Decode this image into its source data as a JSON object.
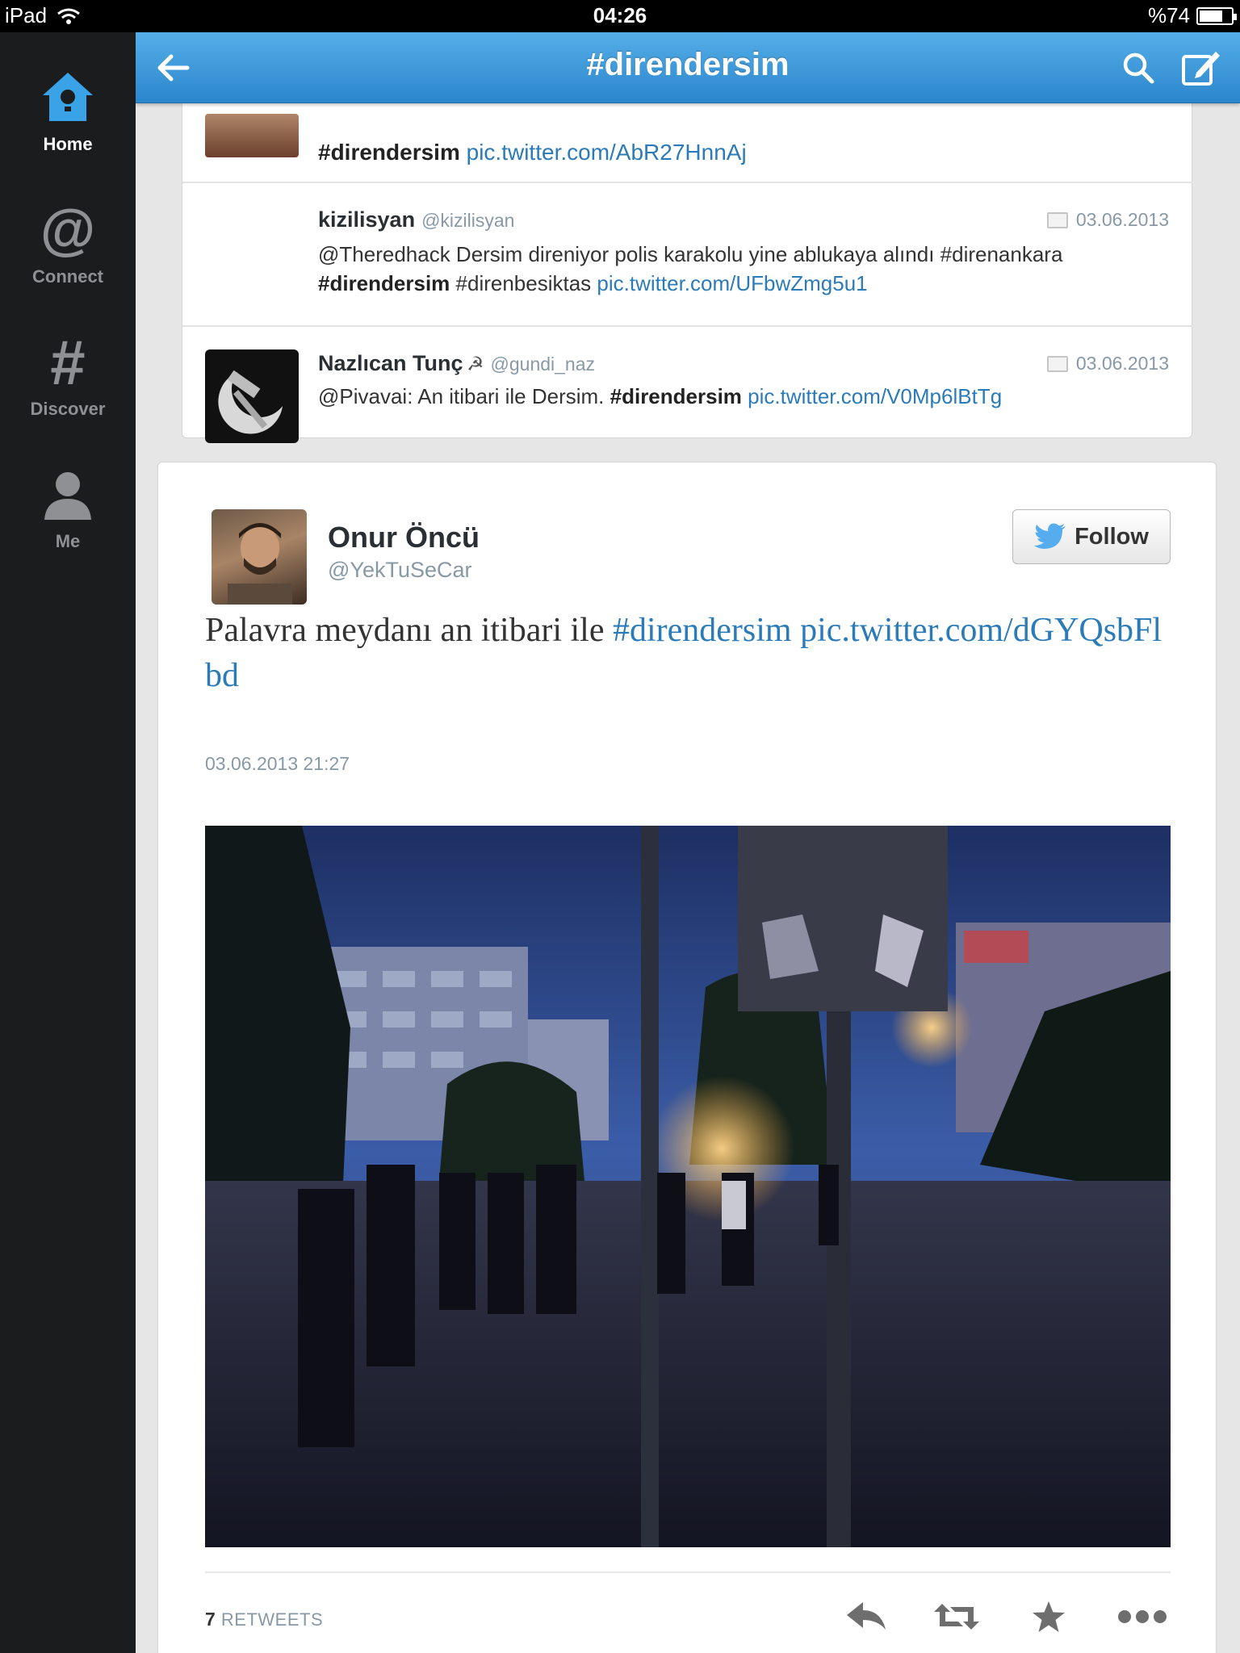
{
  "status": {
    "device": "iPad",
    "time": "04:26",
    "battery": "%74",
    "battery_level": 0.74
  },
  "sidebar": {
    "items": [
      {
        "label": "Home",
        "icon": "home-icon",
        "active": true
      },
      {
        "label": "Connect",
        "icon": "at-icon",
        "active": false
      },
      {
        "label": "Discover",
        "icon": "hash-icon",
        "active": false
      },
      {
        "label": "Me",
        "icon": "person-icon",
        "active": false
      }
    ]
  },
  "header": {
    "title": "#direndersim"
  },
  "timeline": {
    "partial_top": {
      "hashtag": "#direndersim",
      "link": "pic.twitter.com/AbR27HnnAj"
    },
    "tweets": [
      {
        "name": "kizilisyan",
        "handle": "@kizilisyan",
        "date": "03.06.2013",
        "text_1": "@Theredhack  Dersim direniyor polis karakolu yine ablukaya alındı #direnankara",
        "hashtag": "#direndersim",
        "text_2": "#direnbesiktas",
        "link": "pic.twitter.com/UFbwZmg5u1"
      },
      {
        "name": "Nazlıcan Tunç",
        "name_symbol": "☭",
        "handle": "@gundi_naz",
        "date": "03.06.2013",
        "text_1": "@Pivavai: An itibari ile Dersim.",
        "hashtag": "#direndersim",
        "link": "pic.twitter.com/V0Mp6lBtTg"
      }
    ]
  },
  "detail": {
    "name": "Onur Öncü",
    "handle": "@YekTuSeCar",
    "follow_label": "Follow",
    "text": "Palavra meydanı an itibari ile",
    "hashtag": "#direndersim",
    "link": "pic.twitter.com/dGYQsbFlbd",
    "timestamp": "03.06.2013 21:27",
    "retweet_count": "7",
    "retweet_label": "RETWEETS"
  },
  "colors": {
    "accent": "#2b86cc",
    "link": "#2b7bb9",
    "sidebar": "#1b1c1e",
    "twitter_bird": "#55acee"
  }
}
